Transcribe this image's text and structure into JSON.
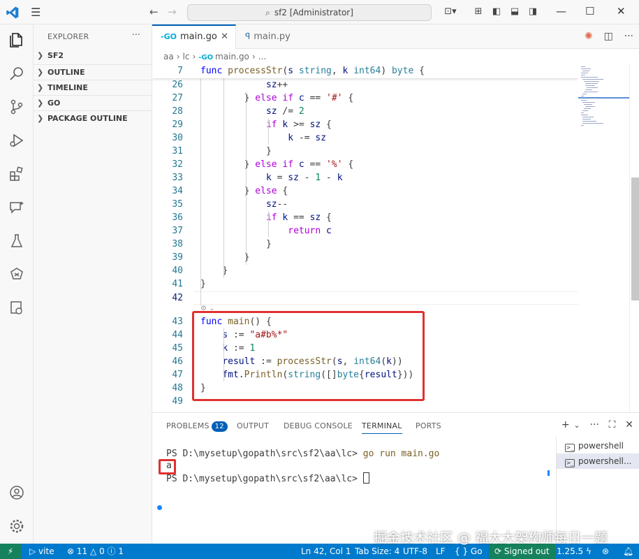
{
  "window": {
    "search_text": "sf2 [Administrator]",
    "icons": [
      "vscode-logo-icon",
      "menu-icon",
      "back-icon",
      "forward-icon",
      "copilot-icon",
      "layout-icon",
      "toggle-sidebar-icon",
      "toggle-panel-icon",
      "toggle-secondary-icon",
      "minimize-icon",
      "maximize-icon",
      "close-icon"
    ]
  },
  "sidebar": {
    "title": "EXPLORER",
    "sections": [
      {
        "label": "SF2"
      },
      {
        "label": "OUTLINE"
      },
      {
        "label": "TIMELINE"
      },
      {
        "label": "GO"
      },
      {
        "label": "PACKAGE OUTLINE"
      }
    ]
  },
  "tabs": [
    {
      "label": "main.go",
      "active": true,
      "icon": "go-file-icon"
    },
    {
      "label": "main.py",
      "active": false,
      "icon": "python-file-icon"
    }
  ],
  "breadcrumb": [
    "aa",
    "lc",
    "main.go",
    "..."
  ],
  "editor": {
    "current_line": "42",
    "lines": [
      {
        "n": "7",
        "text": "func processStr(s string, k int64) byte {"
      },
      {
        "n": "26",
        "text": "            sz++"
      },
      {
        "n": "27",
        "text": "        } else if c == '#' {"
      },
      {
        "n": "28",
        "text": "            sz /= 2"
      },
      {
        "n": "29",
        "text": "            if k >= sz {"
      },
      {
        "n": "30",
        "text": "                k -= sz"
      },
      {
        "n": "31",
        "text": "            }"
      },
      {
        "n": "32",
        "text": "        } else if c == '%' {"
      },
      {
        "n": "33",
        "text": "            k = sz - 1 - k"
      },
      {
        "n": "34",
        "text": "        } else {"
      },
      {
        "n": "35",
        "text": "            sz--"
      },
      {
        "n": "36",
        "text": "            if k == sz {"
      },
      {
        "n": "37",
        "text": "                return c"
      },
      {
        "n": "38",
        "text": "            }"
      },
      {
        "n": "39",
        "text": "        }"
      },
      {
        "n": "40",
        "text": "    }"
      },
      {
        "n": "41",
        "text": "}"
      },
      {
        "n": "42",
        "text": ""
      },
      {
        "n": "43",
        "text": "func main() {"
      },
      {
        "n": "44",
        "text": "    s := \"a#b%*\""
      },
      {
        "n": "45",
        "text": "    k := 1"
      },
      {
        "n": "46",
        "text": "    result := processStr(s, int64(k))"
      },
      {
        "n": "47",
        "text": "    fmt.Println(string([]byte{result}))"
      },
      {
        "n": "48",
        "text": "}"
      },
      {
        "n": "49",
        "text": ""
      }
    ]
  },
  "panel": {
    "tabs": [
      {
        "label": "PROBLEMS",
        "badge": "12"
      },
      {
        "label": "OUTPUT"
      },
      {
        "label": "DEBUG CONSOLE"
      },
      {
        "label": "TERMINAL",
        "active": true
      },
      {
        "label": "PORTS"
      }
    ],
    "terminal": {
      "prompt1": "PS D:\\mysetup\\gopath\\src\\sf2\\aa\\lc> ",
      "command": "go run main.go",
      "output": "a",
      "prompt2": "PS D:\\mysetup\\gopath\\src\\sf2\\aa\\lc> "
    },
    "terminal_list": [
      "powershell",
      "powershell..."
    ]
  },
  "statusbar": {
    "vite": "vite",
    "errors": "11",
    "warnings": "0",
    "info": "1",
    "position": "Ln 42, Col 1",
    "tab_size": "Tab Size: 4",
    "encoding": "UTF-8",
    "eol": "LF",
    "language": "Go",
    "account": "Signed out",
    "go_version": "1.25.5"
  },
  "watermark": "掘金技术社区 @ 福大大架构师每日一题"
}
